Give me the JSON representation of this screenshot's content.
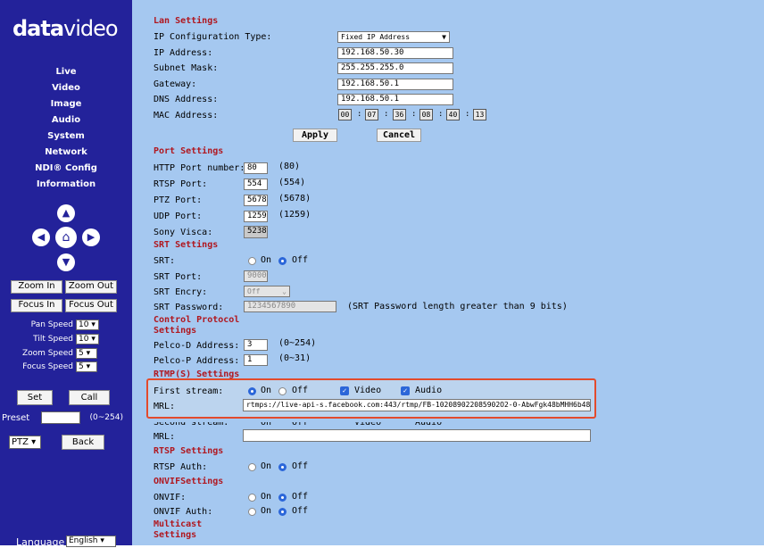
{
  "brand": {
    "logo_bold": "data",
    "logo_thin": "video"
  },
  "nav": [
    "Live",
    "Video",
    "Image",
    "Audio",
    "System",
    "Network",
    "NDI® Config",
    "Information"
  ],
  "ptz_arrows": {
    "up": "▲",
    "down": "▼",
    "left": "◀",
    "right": "▶",
    "home": "⌂"
  },
  "zoom_in": "Zoom In",
  "zoom_out": "Zoom Out",
  "focus_in": "Focus In",
  "focus_out": "Focus Out",
  "speeds": [
    {
      "label": "Pan Speed",
      "value": "10"
    },
    {
      "label": "Tilt Speed",
      "value": "10"
    },
    {
      "label": "Zoom Speed",
      "value": "5"
    },
    {
      "label": "Focus Speed",
      "value": "5"
    }
  ],
  "set": "Set",
  "call": "Call",
  "preset_label": "Preset",
  "preset_range": "(0~254)",
  "ptz_select": "PTZ",
  "back": "Back",
  "language_label": "Language",
  "language_value": "English",
  "lan": {
    "title": "Lan Settings",
    "ip_type_label": "IP Configuration Type:",
    "ip_type_value": "Fixed IP Address",
    "ip_label": "IP Address:",
    "ip_value": "192.168.50.30",
    "subnet_label": "Subnet Mask:",
    "subnet_value": "255.255.255.0",
    "gateway_label": "Gateway:",
    "gateway_value": "192.168.50.1",
    "dns_label": "DNS Address:",
    "dns_value": "192.168.50.1",
    "mac_label": "MAC Address:",
    "mac": [
      "00",
      "07",
      "36",
      "08",
      "40",
      "13"
    ],
    "apply": "Apply",
    "cancel": "Cancel"
  },
  "ports": {
    "title": "Port Settings",
    "http_label": "HTTP Port number:",
    "http_value": "80",
    "http_default": "(80)",
    "rtsp_label": "RTSP Port:",
    "rtsp_value": "554",
    "rtsp_default": "(554)",
    "ptz_label": "PTZ Port:",
    "ptz_value": "5678",
    "ptz_default": "(5678)",
    "udp_label": "UDP Port:",
    "udp_value": "1259",
    "udp_default": "(1259)",
    "visca_label": "Sony Visca:",
    "visca_value": "52381"
  },
  "srt": {
    "title": "SRT Settings",
    "srt_label": "SRT:",
    "on": "On",
    "off": "Off",
    "port_label": "SRT Port:",
    "port_value": "9000",
    "encry_label": "SRT Encry:",
    "encry_value": "Off",
    "password_label": "SRT Password:",
    "password_value": "1234567890",
    "password_hint": "(SRT Password length greater than 9 bits)"
  },
  "control": {
    "title": "Control Protocol Settings",
    "pelco_d_label": "Pelco-D Address:",
    "pelco_d_value": "3",
    "pelco_d_range": "(0~254)",
    "pelco_p_label": "Pelco-P Address:",
    "pelco_p_value": "1",
    "pelco_p_range": "(0~31)"
  },
  "rtmp": {
    "title": "RTMP(S) Settings",
    "first_label": "First stream:",
    "on": "On",
    "off": "Off",
    "video": "Video",
    "audio": "Audio",
    "mrl_label": "MRL:",
    "mrl_value": "rtmps://live-api-s.facebook.com:443/rtmp/FB-102089022085902O2-0-AbwFgk48bMHH6b48",
    "second_label": "Second stream:",
    "mrl2_label": "MRL:"
  },
  "rtsp": {
    "title": "RTSP Settings",
    "auth_label": "RTSP Auth:",
    "on": "On",
    "off": "Off"
  },
  "onvif": {
    "title": "ONVIFSettings",
    "onvif_label": "ONVIF:",
    "auth_label": "ONVIF Auth:",
    "on": "On",
    "off": "Off"
  },
  "multicast": {
    "title": "Multicast Settings"
  }
}
